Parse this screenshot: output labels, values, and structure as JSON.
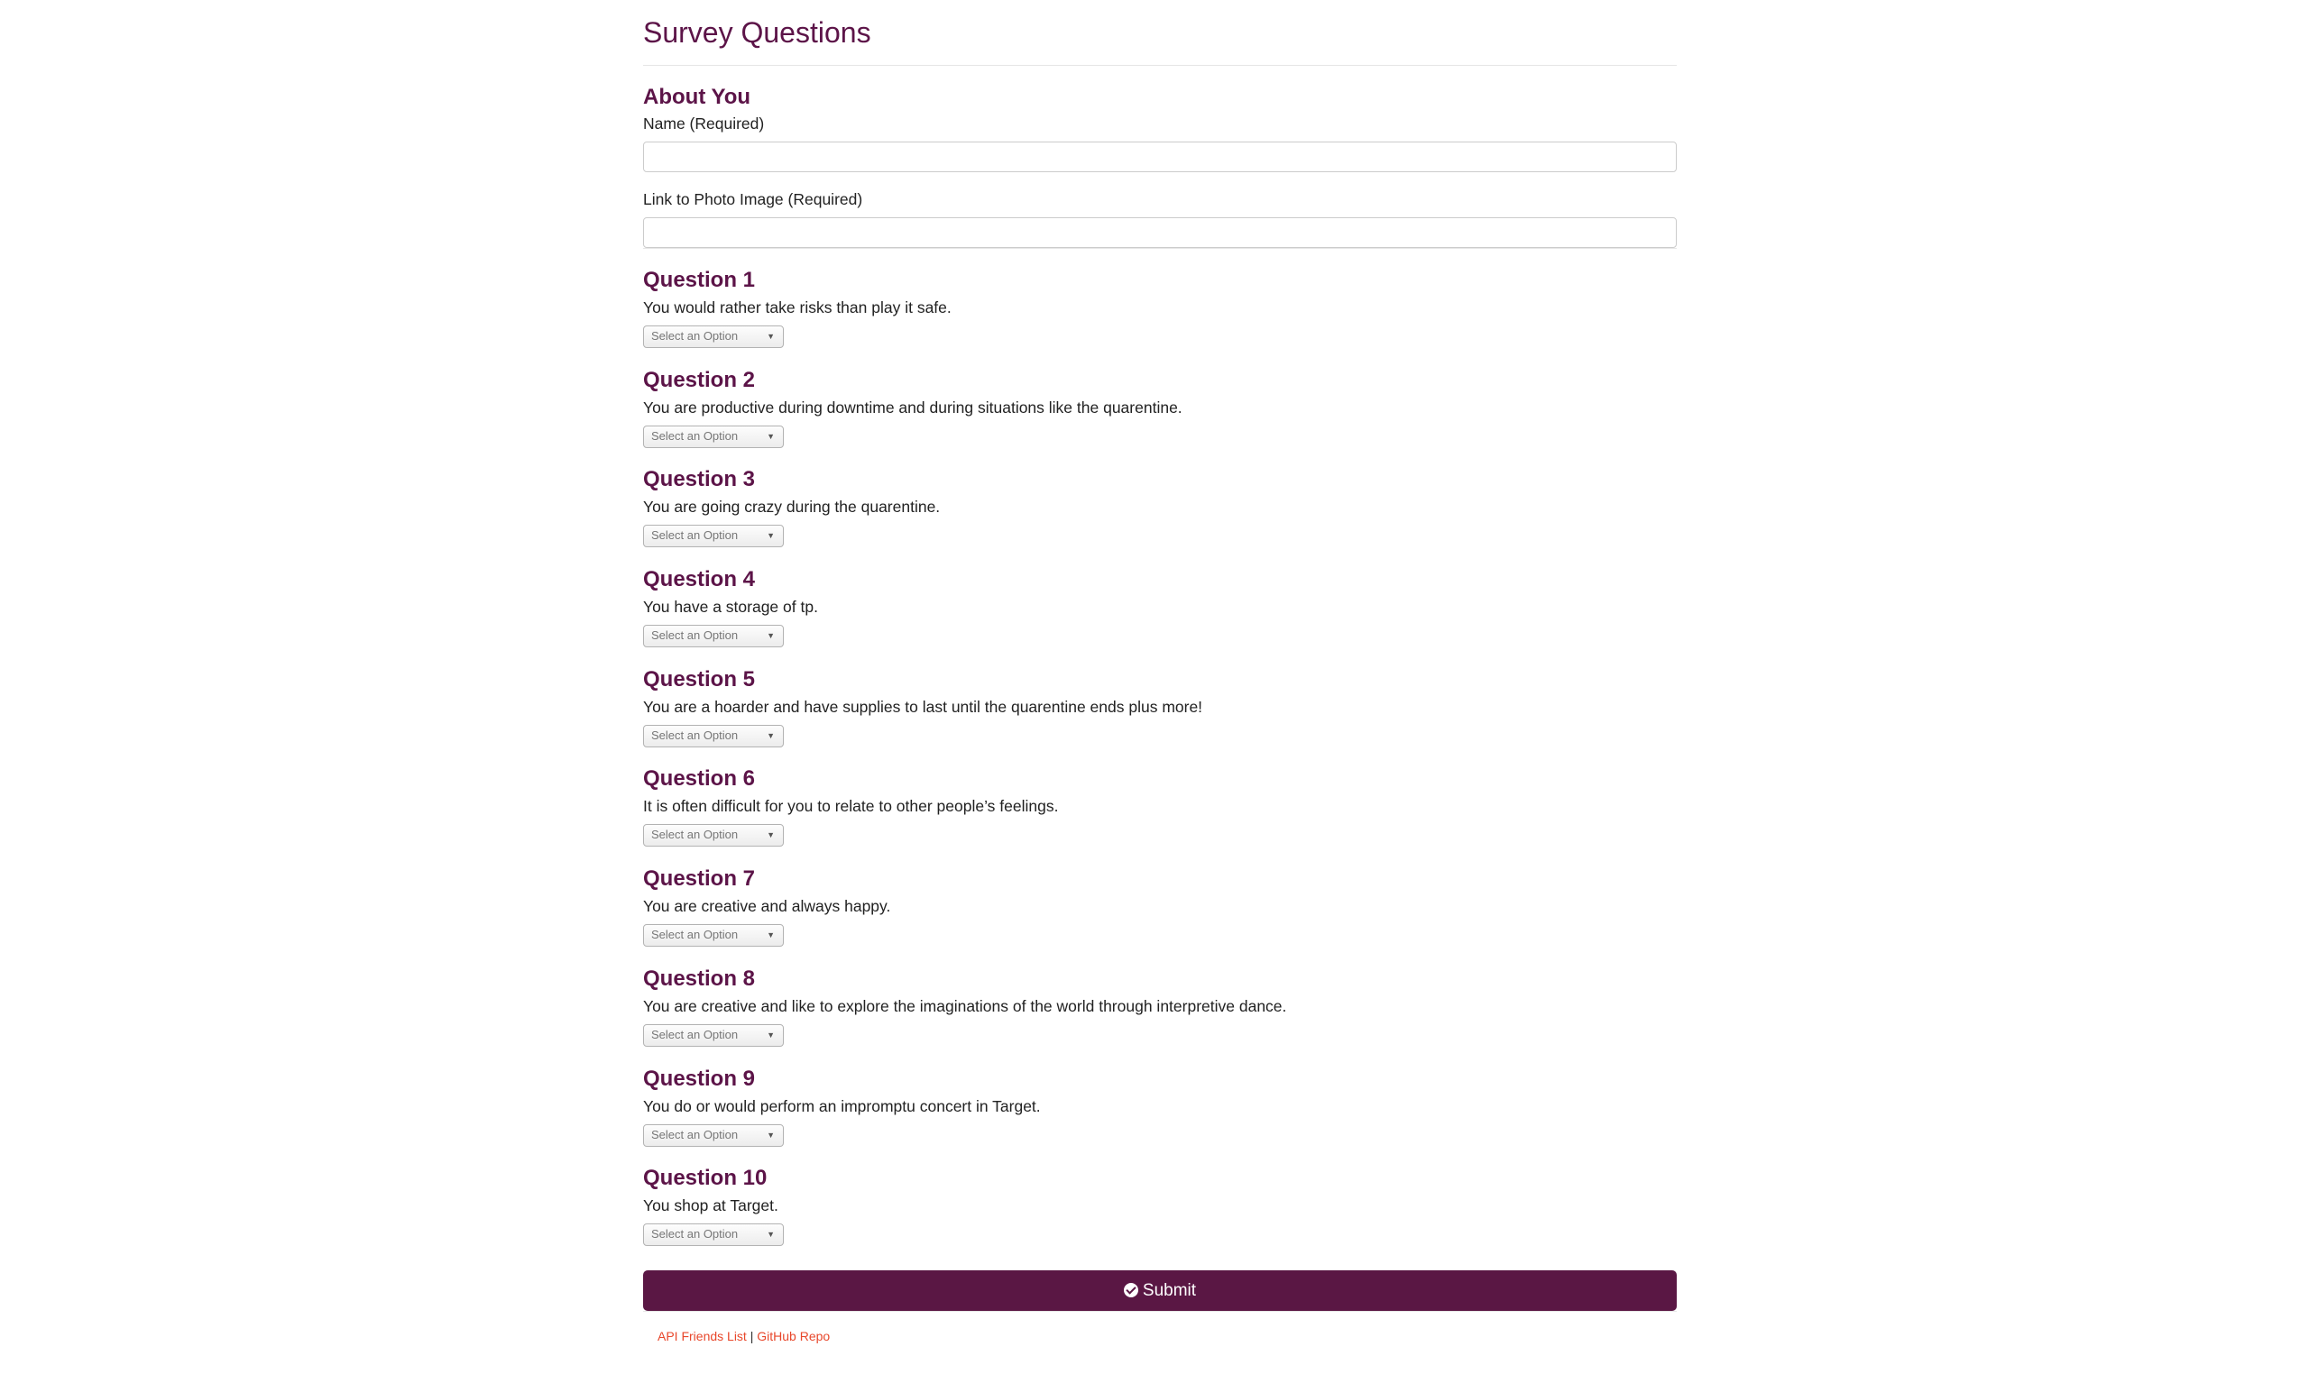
{
  "page": {
    "title": "Survey Questions"
  },
  "about": {
    "heading": "About You",
    "name_label": "Name (Required)",
    "name_value": "",
    "photo_label": "Link to Photo Image (Required)",
    "photo_value": ""
  },
  "select_placeholder": "Select an Option",
  "questions": [
    {
      "title": "Question 1",
      "text": "You would rather take risks than play it safe."
    },
    {
      "title": "Question 2",
      "text": "You are productive during downtime and during situations like the quarentine."
    },
    {
      "title": "Question 3",
      "text": "You are going crazy during the quarentine."
    },
    {
      "title": "Question 4",
      "text": "You have a storage of tp."
    },
    {
      "title": "Question 5",
      "text": "You are a hoarder and have supplies to last until the quarentine ends plus more!"
    },
    {
      "title": "Question 6",
      "text": "It is often difficult for you to relate to other people’s feelings."
    },
    {
      "title": "Question 7",
      "text": "You are creative and always happy."
    },
    {
      "title": "Question 8",
      "text": "You are creative and like to explore the imaginations of the world through interpretive dance."
    },
    {
      "title": "Question 9",
      "text": "You do or would perform an impromptu concert in Target."
    },
    {
      "title": "Question 10",
      "text": "You shop at Target."
    }
  ],
  "submit": {
    "label": "Submit",
    "icon": "check-circle-icon"
  },
  "footer": {
    "link1": "API Friends List",
    "separator": "|",
    "link2": "GitHub Repo"
  },
  "colors": {
    "heading": "#5c1448",
    "submit_bg": "#5a1744",
    "link": "#e8472b"
  }
}
